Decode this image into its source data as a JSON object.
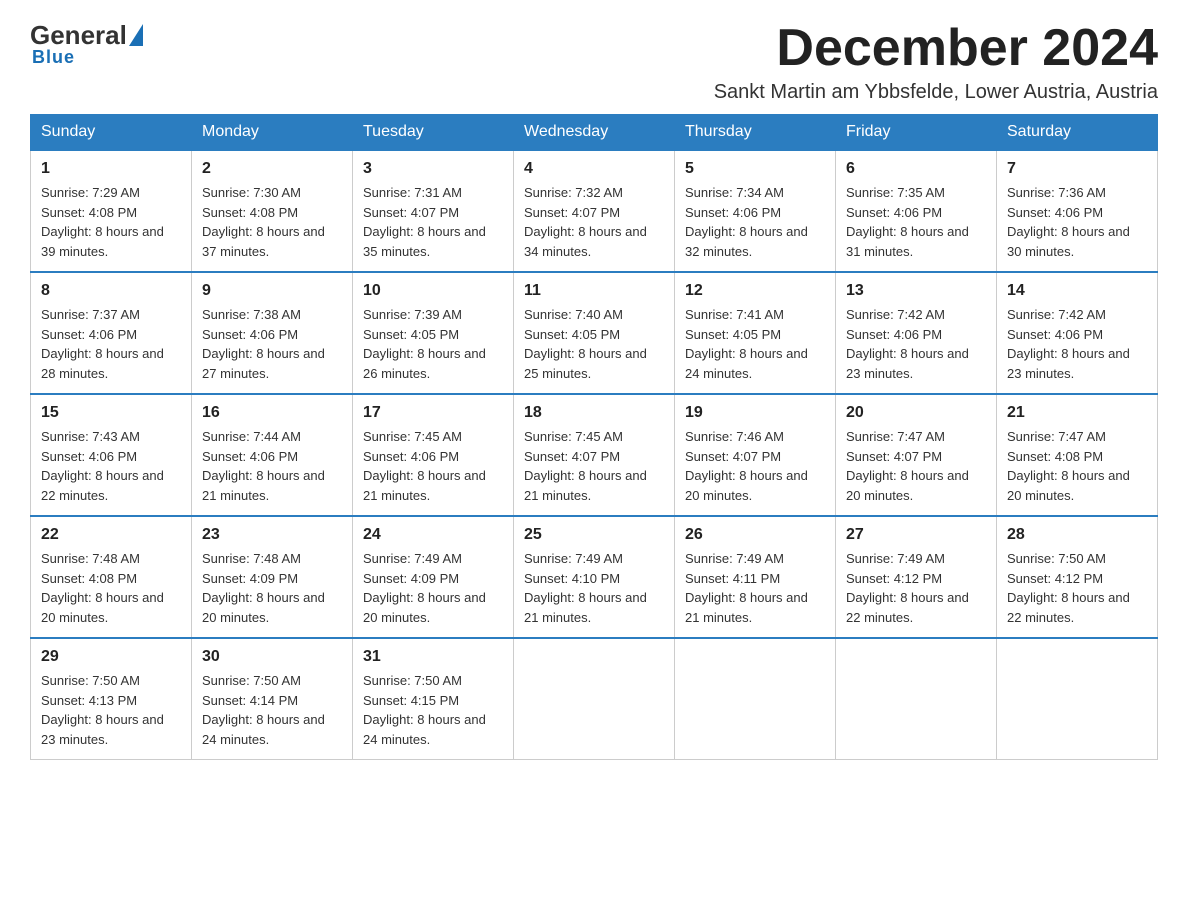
{
  "logo": {
    "general": "General",
    "blue": "Blue",
    "underline": "Blue"
  },
  "header": {
    "month_title": "December 2024",
    "subtitle": "Sankt Martin am Ybbsfelde, Lower Austria, Austria"
  },
  "days_of_week": [
    "Sunday",
    "Monday",
    "Tuesday",
    "Wednesday",
    "Thursday",
    "Friday",
    "Saturday"
  ],
  "weeks": [
    [
      {
        "day": "1",
        "sunrise": "7:29 AM",
        "sunset": "4:08 PM",
        "daylight": "8 hours and 39 minutes."
      },
      {
        "day": "2",
        "sunrise": "7:30 AM",
        "sunset": "4:08 PM",
        "daylight": "8 hours and 37 minutes."
      },
      {
        "day": "3",
        "sunrise": "7:31 AM",
        "sunset": "4:07 PM",
        "daylight": "8 hours and 35 minutes."
      },
      {
        "day": "4",
        "sunrise": "7:32 AM",
        "sunset": "4:07 PM",
        "daylight": "8 hours and 34 minutes."
      },
      {
        "day": "5",
        "sunrise": "7:34 AM",
        "sunset": "4:06 PM",
        "daylight": "8 hours and 32 minutes."
      },
      {
        "day": "6",
        "sunrise": "7:35 AM",
        "sunset": "4:06 PM",
        "daylight": "8 hours and 31 minutes."
      },
      {
        "day": "7",
        "sunrise": "7:36 AM",
        "sunset": "4:06 PM",
        "daylight": "8 hours and 30 minutes."
      }
    ],
    [
      {
        "day": "8",
        "sunrise": "7:37 AM",
        "sunset": "4:06 PM",
        "daylight": "8 hours and 28 minutes."
      },
      {
        "day": "9",
        "sunrise": "7:38 AM",
        "sunset": "4:06 PM",
        "daylight": "8 hours and 27 minutes."
      },
      {
        "day": "10",
        "sunrise": "7:39 AM",
        "sunset": "4:05 PM",
        "daylight": "8 hours and 26 minutes."
      },
      {
        "day": "11",
        "sunrise": "7:40 AM",
        "sunset": "4:05 PM",
        "daylight": "8 hours and 25 minutes."
      },
      {
        "day": "12",
        "sunrise": "7:41 AM",
        "sunset": "4:05 PM",
        "daylight": "8 hours and 24 minutes."
      },
      {
        "day": "13",
        "sunrise": "7:42 AM",
        "sunset": "4:06 PM",
        "daylight": "8 hours and 23 minutes."
      },
      {
        "day": "14",
        "sunrise": "7:42 AM",
        "sunset": "4:06 PM",
        "daylight": "8 hours and 23 minutes."
      }
    ],
    [
      {
        "day": "15",
        "sunrise": "7:43 AM",
        "sunset": "4:06 PM",
        "daylight": "8 hours and 22 minutes."
      },
      {
        "day": "16",
        "sunrise": "7:44 AM",
        "sunset": "4:06 PM",
        "daylight": "8 hours and 21 minutes."
      },
      {
        "day": "17",
        "sunrise": "7:45 AM",
        "sunset": "4:06 PM",
        "daylight": "8 hours and 21 minutes."
      },
      {
        "day": "18",
        "sunrise": "7:45 AM",
        "sunset": "4:07 PM",
        "daylight": "8 hours and 21 minutes."
      },
      {
        "day": "19",
        "sunrise": "7:46 AM",
        "sunset": "4:07 PM",
        "daylight": "8 hours and 20 minutes."
      },
      {
        "day": "20",
        "sunrise": "7:47 AM",
        "sunset": "4:07 PM",
        "daylight": "8 hours and 20 minutes."
      },
      {
        "day": "21",
        "sunrise": "7:47 AM",
        "sunset": "4:08 PM",
        "daylight": "8 hours and 20 minutes."
      }
    ],
    [
      {
        "day": "22",
        "sunrise": "7:48 AM",
        "sunset": "4:08 PM",
        "daylight": "8 hours and 20 minutes."
      },
      {
        "day": "23",
        "sunrise": "7:48 AM",
        "sunset": "4:09 PM",
        "daylight": "8 hours and 20 minutes."
      },
      {
        "day": "24",
        "sunrise": "7:49 AM",
        "sunset": "4:09 PM",
        "daylight": "8 hours and 20 minutes."
      },
      {
        "day": "25",
        "sunrise": "7:49 AM",
        "sunset": "4:10 PM",
        "daylight": "8 hours and 21 minutes."
      },
      {
        "day": "26",
        "sunrise": "7:49 AM",
        "sunset": "4:11 PM",
        "daylight": "8 hours and 21 minutes."
      },
      {
        "day": "27",
        "sunrise": "7:49 AM",
        "sunset": "4:12 PM",
        "daylight": "8 hours and 22 minutes."
      },
      {
        "day": "28",
        "sunrise": "7:50 AM",
        "sunset": "4:12 PM",
        "daylight": "8 hours and 22 minutes."
      }
    ],
    [
      {
        "day": "29",
        "sunrise": "7:50 AM",
        "sunset": "4:13 PM",
        "daylight": "8 hours and 23 minutes."
      },
      {
        "day": "30",
        "sunrise": "7:50 AM",
        "sunset": "4:14 PM",
        "daylight": "8 hours and 24 minutes."
      },
      {
        "day": "31",
        "sunrise": "7:50 AM",
        "sunset": "4:15 PM",
        "daylight": "8 hours and 24 minutes."
      },
      null,
      null,
      null,
      null
    ]
  ],
  "labels": {
    "sunrise": "Sunrise:",
    "sunset": "Sunset:",
    "daylight": "Daylight:"
  }
}
